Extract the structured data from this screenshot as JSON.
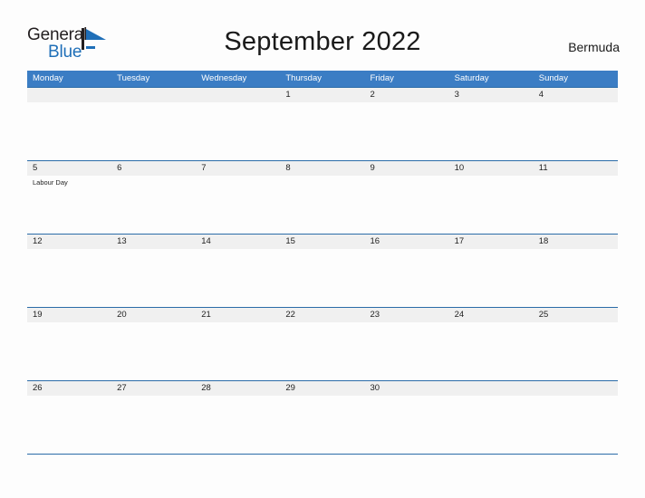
{
  "logo": {
    "text_primary": "General",
    "text_secondary": "Blue",
    "flag_icon": "blue-flag-triangle-icon",
    "flag_color": "#1f6fb8"
  },
  "header": {
    "title": "September 2022",
    "region": "Bermuda"
  },
  "colors": {
    "header_bar": "#3b7dc4",
    "row_band": "#f0f0f0",
    "row_rule": "#2b6ca8",
    "brand_blue": "#1f6fb8",
    "page_background": "#fdfdfd",
    "text": "#222222"
  },
  "calendar": {
    "month": "September",
    "year": "2022",
    "weekday_headers": [
      "Monday",
      "Tuesday",
      "Wednesday",
      "Thursday",
      "Friday",
      "Saturday",
      "Sunday"
    ],
    "weeks": [
      [
        {
          "day": "",
          "event": ""
        },
        {
          "day": "",
          "event": ""
        },
        {
          "day": "",
          "event": ""
        },
        {
          "day": "1",
          "event": ""
        },
        {
          "day": "2",
          "event": ""
        },
        {
          "day": "3",
          "event": ""
        },
        {
          "day": "4",
          "event": ""
        }
      ],
      [
        {
          "day": "5",
          "event": "Labour Day"
        },
        {
          "day": "6",
          "event": ""
        },
        {
          "day": "7",
          "event": ""
        },
        {
          "day": "8",
          "event": ""
        },
        {
          "day": "9",
          "event": ""
        },
        {
          "day": "10",
          "event": ""
        },
        {
          "day": "11",
          "event": ""
        }
      ],
      [
        {
          "day": "12",
          "event": ""
        },
        {
          "day": "13",
          "event": ""
        },
        {
          "day": "14",
          "event": ""
        },
        {
          "day": "15",
          "event": ""
        },
        {
          "day": "16",
          "event": ""
        },
        {
          "day": "17",
          "event": ""
        },
        {
          "day": "18",
          "event": ""
        }
      ],
      [
        {
          "day": "19",
          "event": ""
        },
        {
          "day": "20",
          "event": ""
        },
        {
          "day": "21",
          "event": ""
        },
        {
          "day": "22",
          "event": ""
        },
        {
          "day": "23",
          "event": ""
        },
        {
          "day": "24",
          "event": ""
        },
        {
          "day": "25",
          "event": ""
        }
      ],
      [
        {
          "day": "26",
          "event": ""
        },
        {
          "day": "27",
          "event": ""
        },
        {
          "day": "28",
          "event": ""
        },
        {
          "day": "29",
          "event": ""
        },
        {
          "day": "30",
          "event": ""
        },
        {
          "day": "",
          "event": ""
        },
        {
          "day": "",
          "event": ""
        }
      ]
    ]
  }
}
